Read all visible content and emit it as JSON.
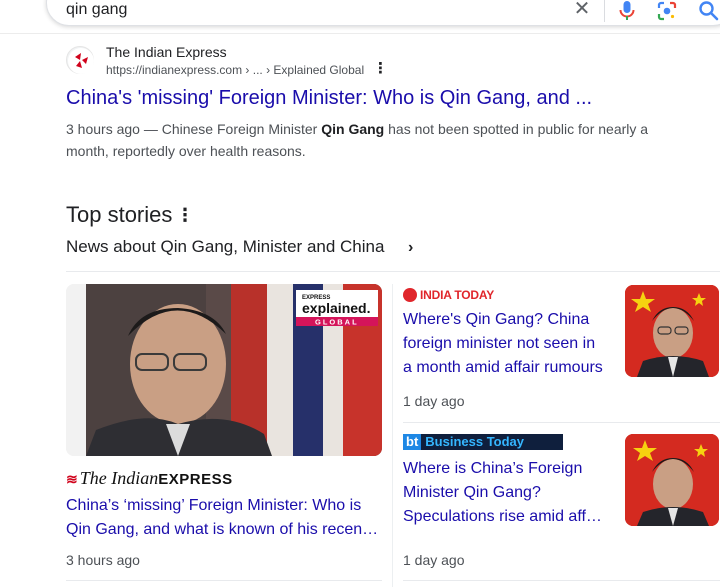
{
  "search": {
    "query": "qin gang",
    "clear_icon": "close-icon",
    "mic_icon": "microphone-icon",
    "lens_icon": "google-lens-icon",
    "search_icon": "search-icon"
  },
  "result": {
    "site_name": "The Indian Express",
    "site_url": "https://indianexpress.com › ... › Explained Global",
    "title": "China's 'missing' Foreign Minister: Who is Qin Gang, and ...",
    "snippet_prefix": "3 hours ago — Chinese Foreign Minister ",
    "snippet_bold": "Qin Gang",
    "snippet_suffix": " has not been spotted in public for nearly a month, reportedly over health reasons."
  },
  "top_stories": {
    "heading": "Top stories",
    "news_about": "News about Qin Gang, Minister and China",
    "big_card": {
      "badge_top": "EXPRESS",
      "badge_main": "explained.",
      "badge_sub": "GLOBAL",
      "source_mark": "",
      "source_word": "The Indian",
      "source_caps": "EXPRESS",
      "title_line1": "China’s ‘missing’ Foreign Minister: Who is",
      "title_line2": "Qin Gang, and what is known of his recen…",
      "time": "3 hours ago"
    },
    "cards": [
      {
        "source": "INDIA TODAY",
        "title_line1": "Where's Qin Gang? China",
        "title_line2": "foreign minister not seen in",
        "title_line3": "a month amid affair rumours",
        "time": "1 day ago"
      },
      {
        "source_mark": "bt",
        "source": "Business Today",
        "title_line1": "Where is China’s Foreign",
        "title_line2": "Minister Qin Gang?",
        "title_line3": "Speculations rise amid aff…",
        "time": "1 day ago"
      }
    ]
  },
  "colors": {
    "link": "#1a0dab",
    "snippet": "#4d5156",
    "india_today_red": "#e0262b",
    "explained_pink": "#d4145a"
  }
}
